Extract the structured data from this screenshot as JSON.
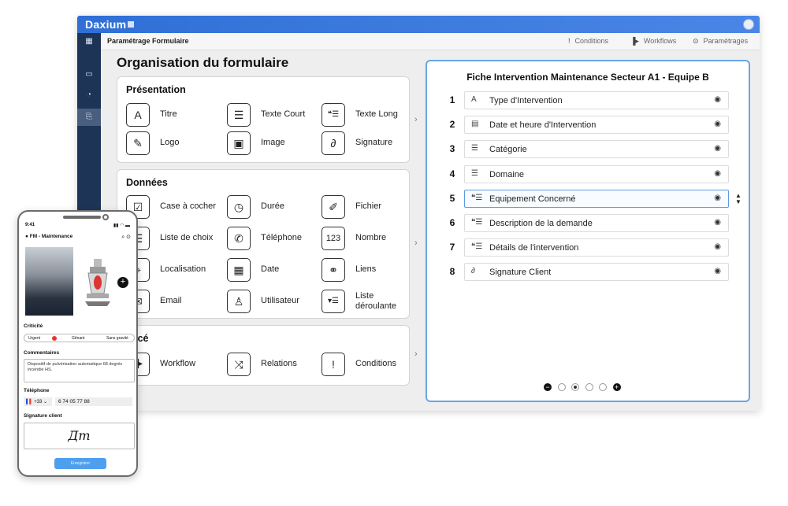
{
  "app": {
    "name": "Daxium"
  },
  "toolbar": {
    "title": "Paramétrage Formulaire",
    "conditions": "Conditions",
    "workflows": "Workflows",
    "parametrages": "Paramétrages"
  },
  "main": {
    "title": "Organisation du formulaire"
  },
  "sections": [
    {
      "title": "Présentation",
      "fields": [
        {
          "label": "Titre",
          "icon": "A"
        },
        {
          "label": "Texte Court",
          "icon": "☰"
        },
        {
          "label": "Texte Long",
          "icon": "❝☰"
        },
        {
          "label": "Logo",
          "icon": "✎"
        },
        {
          "label": "Image",
          "icon": "▣"
        },
        {
          "label": "Signature",
          "icon": "∂"
        }
      ]
    },
    {
      "title": "Données",
      "fields": [
        {
          "label": "Case à cocher",
          "icon": "☑"
        },
        {
          "label": "Durée",
          "icon": "◷"
        },
        {
          "label": "Fichier",
          "icon": "✐"
        },
        {
          "label": "Liste de choix",
          "icon": "☰"
        },
        {
          "label": "Téléphone",
          "icon": "✆"
        },
        {
          "label": "Nombre",
          "icon": "123"
        },
        {
          "label": "Localisation",
          "icon": "⌖"
        },
        {
          "label": "Date",
          "icon": "▦"
        },
        {
          "label": "Liens",
          "icon": "⚭"
        },
        {
          "label": "Email",
          "icon": "✉"
        },
        {
          "label": "Utilisateur",
          "icon": "♙"
        },
        {
          "label": "Liste déroulante",
          "icon": "▾☰"
        }
      ]
    },
    {
      "title": "ancé",
      "fields": [
        {
          "label": "Workflow",
          "icon": "▐▸"
        },
        {
          "label": "Relations",
          "icon": "⤨"
        },
        {
          "label": "Conditions",
          "icon": "!"
        }
      ]
    }
  ],
  "form": {
    "title": "Fiche Intervention Maintenance Secteur A1 - Equipe B",
    "rows": [
      {
        "num": "1",
        "icon": "A",
        "label": "Type d'Intervention"
      },
      {
        "num": "2",
        "icon": "▤",
        "label": "Date et heure d'Intervention"
      },
      {
        "num": "3",
        "icon": "☰",
        "label": "Catégorie"
      },
      {
        "num": "4",
        "icon": "☰",
        "label": "Domaine"
      },
      {
        "num": "5",
        "icon": "❝☰",
        "label": "Equipement Concerné"
      },
      {
        "num": "6",
        "icon": "❝☰",
        "label": "Description de la demande"
      },
      {
        "num": "7",
        "icon": "❝☰",
        "label": "Détails de l'intervention"
      },
      {
        "num": "8",
        "icon": "∂",
        "label": "Signature Client"
      }
    ],
    "selected_row": 5,
    "pager": {
      "pages": 4,
      "current": 2
    }
  },
  "phone": {
    "time": "9:41",
    "title": "FM - Maintenance",
    "criticite_label": "Criticité",
    "criticite_options": [
      "Urgent",
      "Gênant",
      "Sans gravité"
    ],
    "commentaires_label": "Commentaires",
    "commentaires_value": "Dispositif de pulvérisation automatique 68 degrés incendie HS.",
    "telephone_label": "Téléphone",
    "phone_code": "+33",
    "phone_number": "6 74 05 77 88",
    "signature_label": "Signature client",
    "submit_label": "Enregistrer"
  },
  "colors": {
    "accent": "#3b7be0",
    "sidebar": "#1e3457",
    "selection": "#5b9be0"
  }
}
